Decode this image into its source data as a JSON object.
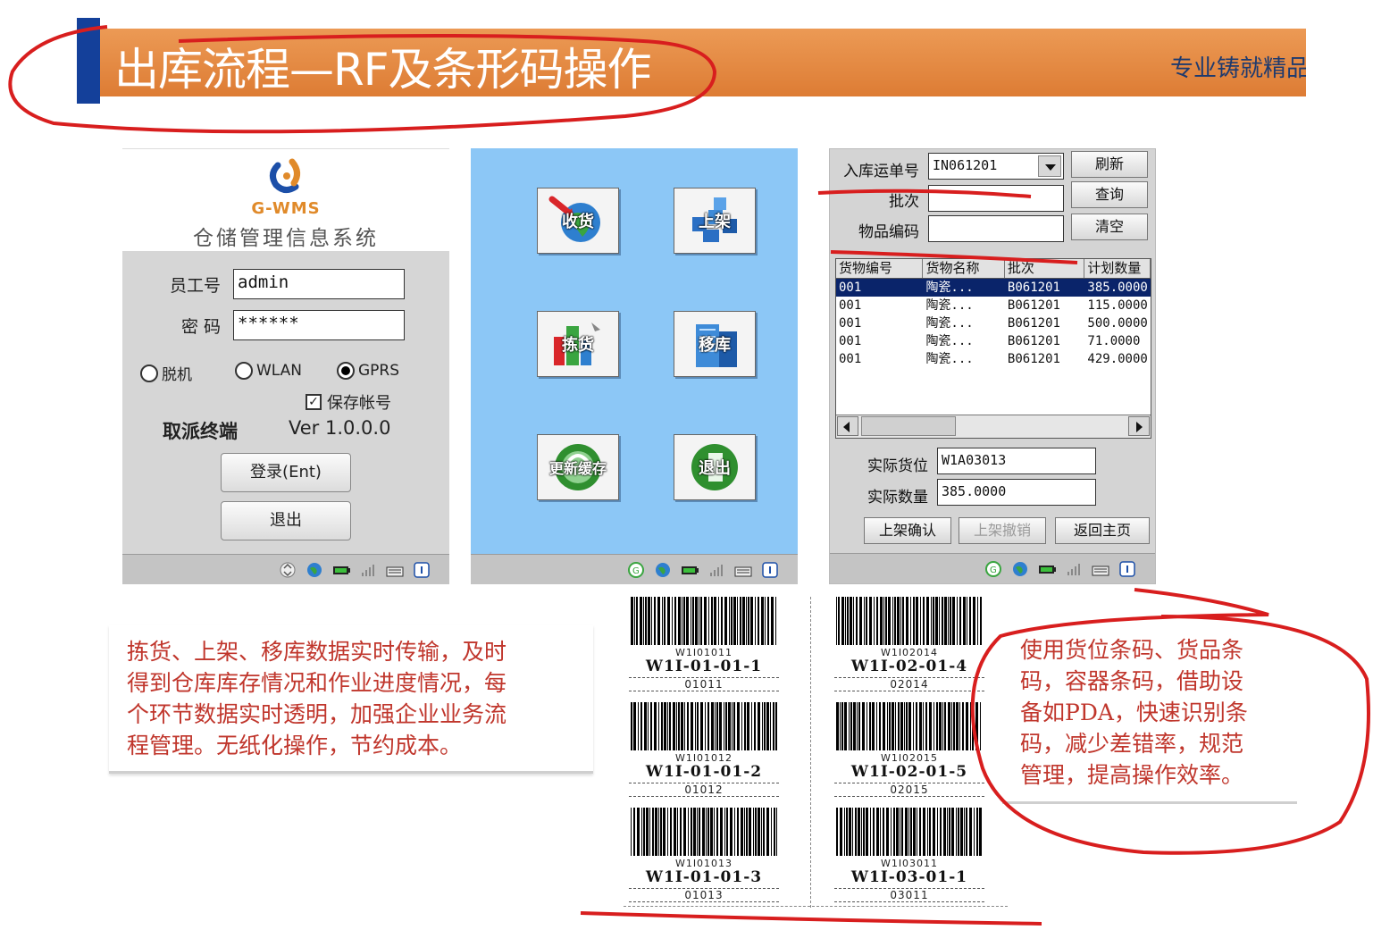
{
  "slide": {
    "title": "出库流程—RF及条形码操作",
    "tagline": "专业铸就精品"
  },
  "login": {
    "logo_name": "G-WMS",
    "system_name": "仓储管理信息系统",
    "employee_label": "员工号",
    "employee_value": "admin",
    "password_label": "密 码",
    "password_value": "******",
    "radio_offline": "脱机",
    "radio_wlan": "WLAN",
    "radio_gprs": "GPRS",
    "selected_mode": "GPRS",
    "save_account_label": "保存帐号",
    "save_account_checked": true,
    "terminal_label": "取派终端",
    "version": "Ver 1.0.0.0",
    "login_button": "登录(Ent)",
    "exit_button": "退出"
  },
  "menu": {
    "tiles": [
      {
        "label": "收货",
        "icon": "globe-arrow-icon"
      },
      {
        "label": "上架",
        "icon": "cubes-icon"
      },
      {
        "label": "拣货",
        "icon": "picking-icon"
      },
      {
        "label": "移库",
        "icon": "building-icon"
      },
      {
        "label": "更新缓存",
        "icon": "refresh-icon"
      },
      {
        "label": "退出",
        "icon": "exit-door-icon"
      }
    ]
  },
  "inbound": {
    "order_label": "入库运单号",
    "order_value": "IN061201",
    "batch_label": "批次",
    "batch_value": "",
    "item_code_label": "物品编码",
    "item_code_value": "",
    "refresh_button": "刷新",
    "query_button": "查询",
    "clear_button": "清空",
    "columns": [
      "货物编号",
      "货物名称",
      "批次",
      "计划数量"
    ],
    "rows": [
      [
        "001",
        "陶瓷...",
        "B061201",
        "385.0000"
      ],
      [
        "001",
        "陶瓷...",
        "B061201",
        "115.0000"
      ],
      [
        "001",
        "陶瓷...",
        "B061201",
        "500.0000"
      ],
      [
        "001",
        "陶瓷...",
        "B061201",
        "71.0000"
      ],
      [
        "001",
        "陶瓷...",
        "B061201",
        "429.0000"
      ]
    ],
    "actual_location_label": "实际货位",
    "actual_location_value": "W1A03013",
    "actual_qty_label": "实际数量",
    "actual_qty_value": "385.0000",
    "confirm_button": "上架确认",
    "cancel_button": "上架撤销",
    "home_button": "返回主页"
  },
  "barcodes": [
    {
      "small": "W1I01011",
      "main": "W1I-01-01-1",
      "sub": "01011"
    },
    {
      "small": "W1I02014",
      "main": "W1I-02-01-4",
      "sub": "02014"
    },
    {
      "small": "W1I01012",
      "main": "W1I-01-01-2",
      "sub": "01012"
    },
    {
      "small": "W1I02015",
      "main": "W1I-02-01-5",
      "sub": "02015"
    },
    {
      "small": "W1I01013",
      "main": "W1I-01-01-3",
      "sub": "01013"
    },
    {
      "small": "W1I03011",
      "main": "W1I-03-01-1",
      "sub": "03011"
    }
  ],
  "text": {
    "left": [
      "拣货、上架、移库数据实时传输，及时",
      "得到仓库库存情况和作业进度情况，每",
      "个环节数据实时透明，加强企业业务流",
      "程管理。无纸化操作，节约成本。"
    ],
    "right": [
      "使用货位条码、货品条",
      "码，容器条码，借助设",
      "备如PDA，快速识别条",
      "码，减少差错率，规范",
      "管理，提高操作效率。"
    ]
  },
  "colors": {
    "title_bar": "#e0853a",
    "title_accent": "#14409a",
    "body_text": "#c0362c",
    "menu_bg": "#8cc7f6",
    "annotation_red": "#d81e1e"
  }
}
